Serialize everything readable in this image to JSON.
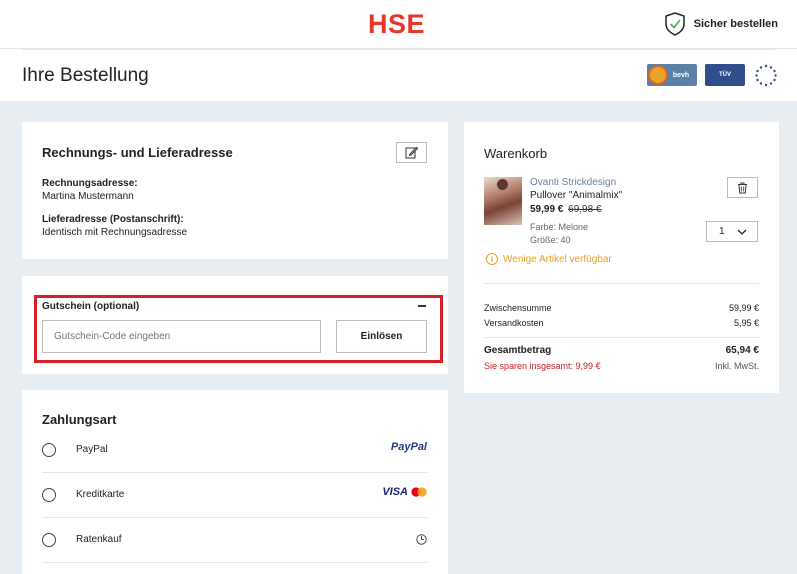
{
  "header": {
    "logo": "HSE",
    "secure_label": "Sicher bestellen",
    "page_title": "Ihre Bestellung",
    "seal_ehi": "bevh",
    "seal_tuv": "TÜV"
  },
  "address": {
    "title": "Rechnungs- und Lieferadresse",
    "billing_label": "Rechnungsadresse:",
    "billing_value": "Martina Mustermann",
    "delivery_label": "Lieferadresse (Postanschrift):",
    "delivery_value": "Identisch mit Rechnungsadresse"
  },
  "voucher": {
    "title": "Gutschein (optional)",
    "placeholder": "Gutschein-Code eingeben",
    "button": "Einlösen"
  },
  "payment": {
    "title": "Zahlungsart",
    "options": [
      {
        "label": "PayPal",
        "logo": "PayPal"
      },
      {
        "label": "Kreditkarte",
        "logo": "VISA"
      },
      {
        "label": "Ratenkauf",
        "logo": "clock-icon"
      }
    ]
  },
  "cart": {
    "title": "Warenkorb",
    "item": {
      "brand": "Ovanti Strickdesign",
      "name": "Pullover \"Animalmix\"",
      "price": "59,99 €",
      "old_price": "69,98 €",
      "color": "Farbe: Melone",
      "size": "Größe: 40",
      "quantity": "1"
    },
    "availability": "Wenige Artikel verfügbar",
    "subtotal_label": "Zwischensumme",
    "subtotal_value": "59,99 €",
    "shipping_label": "Versandkosten",
    "shipping_value": "5,95 €",
    "total_label": "Gesamtbetrag",
    "total_value": "65,94 €",
    "savings": "Sie sparen insgesamt: 9,99 €",
    "vat": "Inkl. MwSt."
  },
  "colors": {
    "brand_red": "#e7362a",
    "highlight_red": "#d62027",
    "availability_orange": "#e8a024",
    "brand_blue": "#6b7f99"
  }
}
